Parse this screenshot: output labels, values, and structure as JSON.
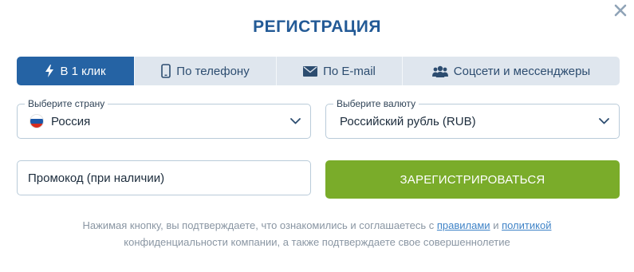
{
  "close": {
    "icon": "close-icon"
  },
  "title": "РЕГИСТРАЦИЯ",
  "tabs": [
    {
      "label": "В 1 клик",
      "icon": "lightning-icon",
      "active": true
    },
    {
      "label": "По телефону",
      "icon": "phone-icon",
      "active": false
    },
    {
      "label": "По E-mail",
      "icon": "envelope-icon",
      "active": false
    },
    {
      "label": "Соцсети и мессенджеры",
      "icon": "users-icon",
      "active": false
    }
  ],
  "country": {
    "label": "Выберите страну",
    "value": "Россия",
    "flag_colors": [
      "#ffffff",
      "#1c57a7",
      "#d52b1e"
    ]
  },
  "currency": {
    "label": "Выберите валюту",
    "value": "Российский рубль (RUB)"
  },
  "promo": {
    "placeholder": "Промокод (при наличии)"
  },
  "register_button": {
    "label": "ЗАРЕГИСТРИРОВАТЬСЯ"
  },
  "disclaimer": {
    "text_before": "Нажимая кнопку, вы подтверждаете, что ознакомились и соглашаетесь с ",
    "rules_link": "правилами",
    "text_and": " и ",
    "policy_link": "политикой",
    "text_after": " конфиденциальности компании, а также подтверждаете свое совершеннолетие"
  },
  "colors": {
    "primary": "#235a96",
    "tab_active": "#2563a4",
    "tab_bg": "#dfe6ee",
    "register": "#7aac2a",
    "link": "#3f83c7"
  }
}
